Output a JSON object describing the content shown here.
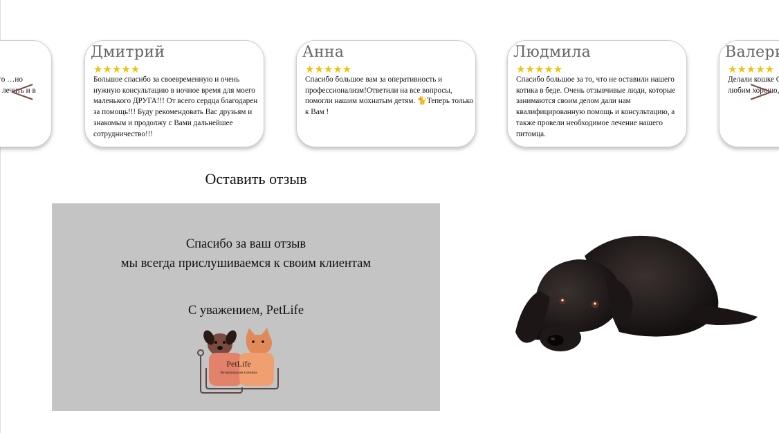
{
  "reviews": [
    {
      "name": "",
      "stars": "★★★★★",
      "text": "клинике. …ого …но кота. и дала к лечить и в"
    },
    {
      "name": "Дмитрий",
      "stars": "★★★★★",
      "text": "Большое спасибо за своевременную и очень нужную консультацию в ночное время для моего маленького ДРУГА!!! От всего сердца благодарен за помощь!!! Буду рекомендовать Вас друзьям и знакомым и продолжу с Вами дальнейшее сотрудничество!!!"
    },
    {
      "name": "Анна",
      "stars": "★★★★★",
      "text": "Спасибо большое вам за оперативность и профессионализм!Ответили на все вопросы, помогли нашим мохнатым детям. 🐈Теперь только к Вам !"
    },
    {
      "name": "Людмила",
      "stars": "★★★★★",
      "text": "Спасибо большое за то, что не оставили нашего котика в беде.  Очень отзывчивые люди, которые занимаются своим делом дали нам квалифицированную помощь и консультацию, а также провели необходимое лечение нашего питомца."
    },
    {
      "name": "Валери",
      "stars": "★★★★★",
      "text": "Делали кошке Специалисты рекомендации своего любим хорошо,больш внимательны"
    }
  ],
  "carousel": {
    "prev_label": "<",
    "next_label": ">"
  },
  "feedback": {
    "title": "Оставить отзыв",
    "line1": "Спасибо за ваш отзыв",
    "line2": "мы всегда прислушиваемся к своим клиентам",
    "line3": "С уважением, PetLife"
  },
  "logo": {
    "brand": "PetLife",
    "subtitle": "Ветеринарная клиника"
  },
  "colors": {
    "star": "#f5c00a",
    "arrow": "#7a4f45",
    "feedback_bg": "#c4c4c4"
  }
}
